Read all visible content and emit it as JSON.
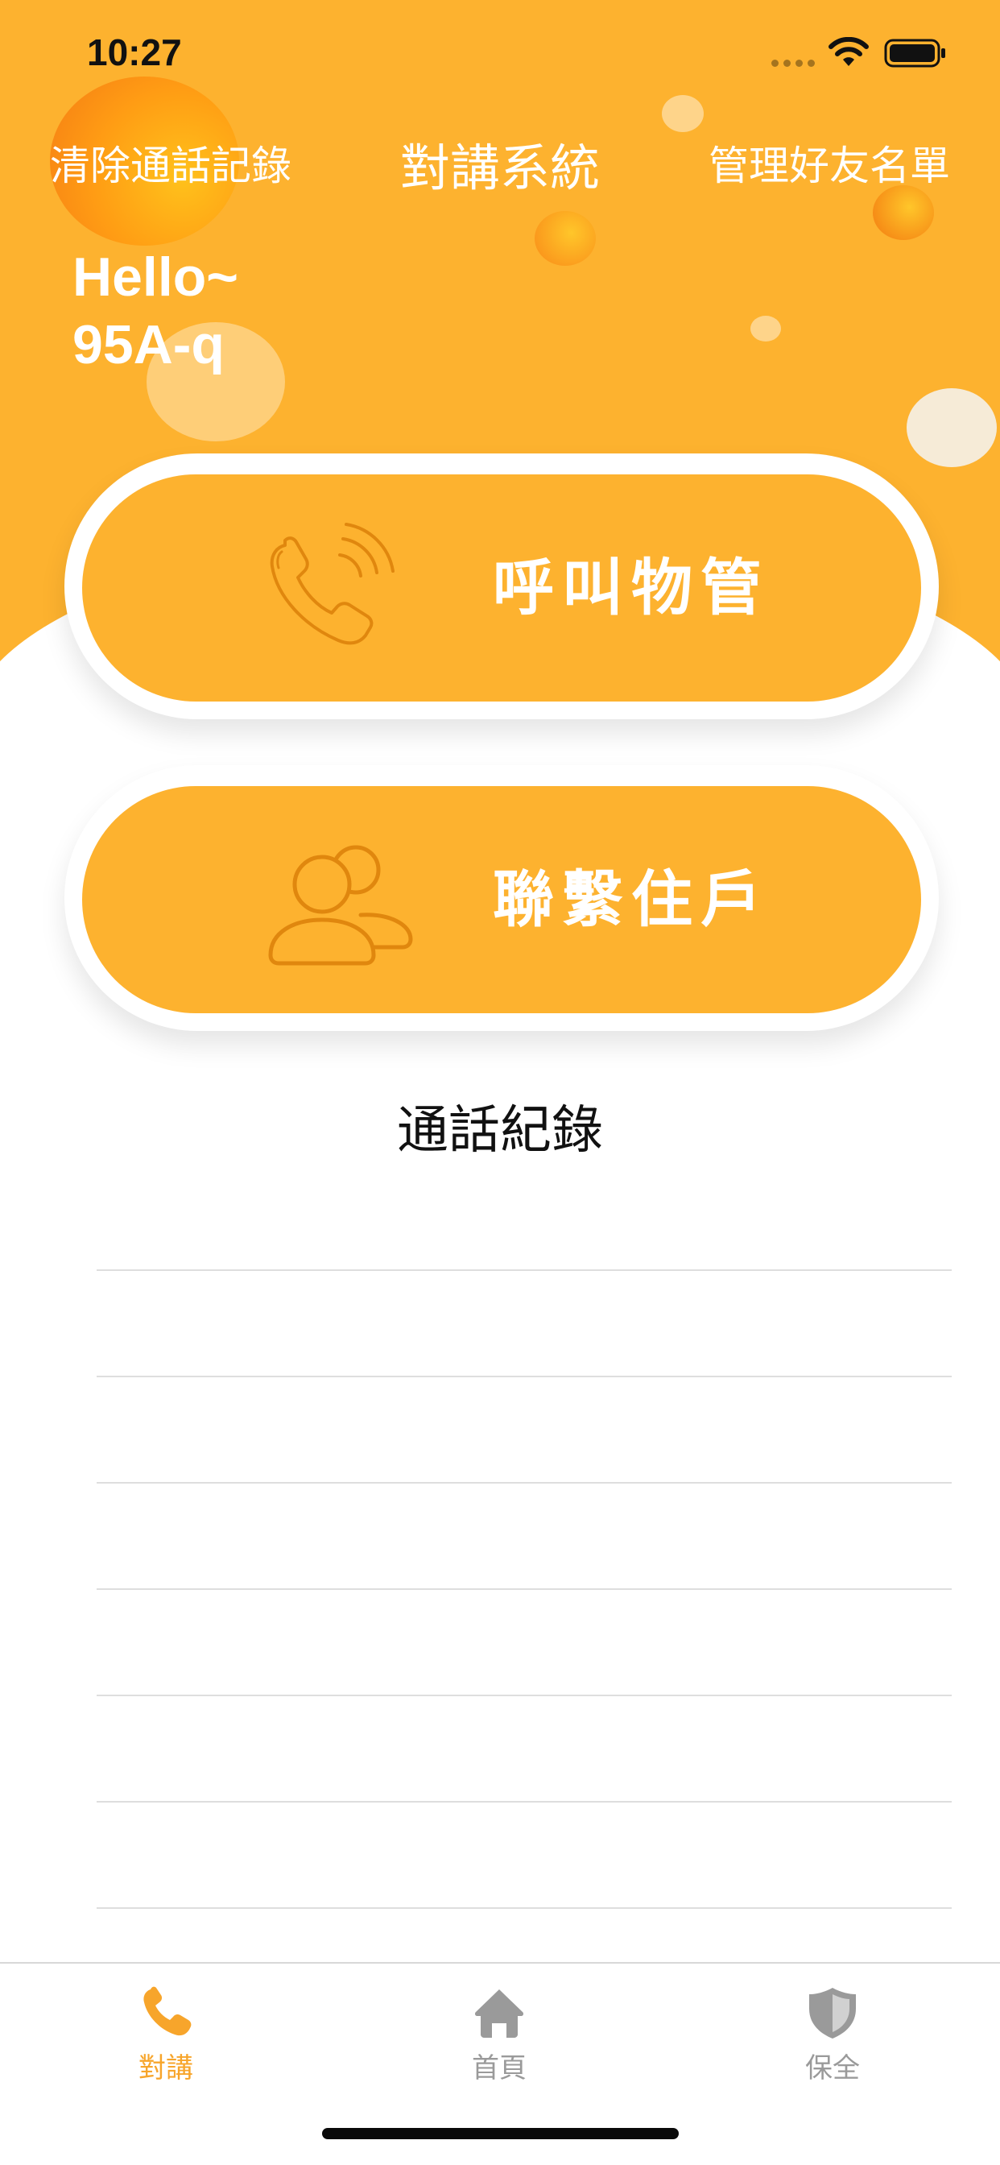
{
  "status_bar": {
    "time": "10:27"
  },
  "nav": {
    "left_action": "清除通話記錄",
    "title": "對講系統",
    "right_action": "管理好友名單"
  },
  "greeting": {
    "hello": "Hello~",
    "unit": "95A-q"
  },
  "actions": {
    "call_management": {
      "label": "呼叫物管",
      "icon": "phone-calling-icon"
    },
    "contact_residents": {
      "label": "聯繫住戶",
      "icon": "users-icon"
    }
  },
  "call_log": {
    "title": "通話紀錄",
    "rows": [
      "",
      "",
      "",
      "",
      "",
      "",
      ""
    ]
  },
  "tab_bar": {
    "tabs": [
      {
        "label": "對講",
        "icon": "phone-icon",
        "active": true
      },
      {
        "label": "首頁",
        "icon": "home-icon",
        "active": false
      },
      {
        "label": "保全",
        "icon": "shield-icon",
        "active": false
      }
    ]
  },
  "colors": {
    "accent": "#FDB22F",
    "icon_stroke": "#E0870E",
    "active_tab": "#F7A52B",
    "inactive_tab": "#9A9A9A"
  }
}
